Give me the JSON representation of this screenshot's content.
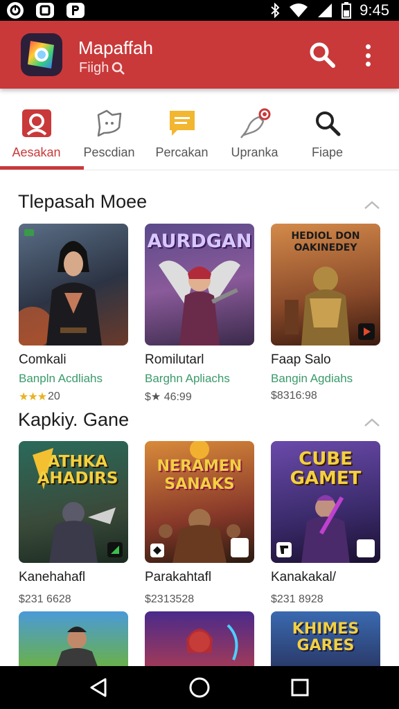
{
  "status_bar": {
    "time": "9:45",
    "left_icons": [
      "ring-icon",
      "square-dot-icon",
      "p-icon"
    ]
  },
  "app_bar": {
    "title": "Mapaffah",
    "subtitle": "Fiigh",
    "brand_color": "#c9393a"
  },
  "tabs": [
    {
      "label": "Aesakan",
      "icon": "person-card-icon",
      "active": true
    },
    {
      "label": "Pescdian",
      "icon": "chat-bubble-icon",
      "active": false
    },
    {
      "label": "Percakan",
      "icon": "message-icon",
      "active": false
    },
    {
      "label": "Upranka",
      "icon": "hand-bell-icon",
      "active": false
    },
    {
      "label": "Fiape",
      "icon": "search-icon",
      "active": false
    }
  ],
  "sections": [
    {
      "title": "Tlepasah Moee",
      "items": [
        {
          "name": "Comkali",
          "developer": "Banpln Acdliahs",
          "meta": "20",
          "rating_stars": 3,
          "thumb_text": ""
        },
        {
          "name": "Romilutarl",
          "developer": "Barghn Apliachs",
          "meta": "$★ 46:99",
          "rating_stars": 0,
          "thumb_text": "AURDGAN"
        },
        {
          "name": "Faap Salo",
          "developer": "Bangin Agdiahs",
          "meta": "$8316:98",
          "rating_stars": 0,
          "thumb_text": "HEDIOL DON OAKINEDEY"
        }
      ]
    },
    {
      "title": "Kapkiy. Gane",
      "items": [
        {
          "name": "Kanehahafl",
          "developer": "",
          "meta": "$231 6628",
          "thumb_text": "ATHKA AHADIRS"
        },
        {
          "name": "Parakahtafl",
          "developer": "",
          "meta": "$2313528",
          "thumb_text": "NERAMEN SANAKS"
        },
        {
          "name": "Kanakakal/",
          "developer": "",
          "meta": "$231 8928",
          "thumb_text": "CUBE GAMET"
        }
      ]
    },
    {
      "title": "",
      "items": [
        {
          "thumb_text": ""
        },
        {
          "thumb_text": ""
        },
        {
          "thumb_text": "KHIMES GARES"
        }
      ]
    }
  ]
}
